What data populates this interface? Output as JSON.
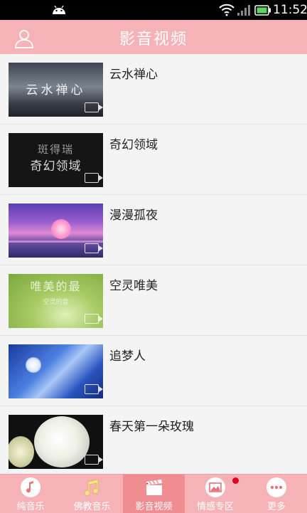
{
  "status_bar": {
    "time": "11:52"
  },
  "header": {
    "title": "影音视频"
  },
  "videos": [
    {
      "name": "云水禅心",
      "thumb_text": "云水禅心"
    },
    {
      "name": "奇幻领域",
      "thumb_text": "奇幻领域",
      "thumb_subtext": "斑得瑞"
    },
    {
      "name": "漫漫孤夜"
    },
    {
      "name": "空灵唯美",
      "thumb_text": "唯美的最",
      "thumb_subtext": "空灵的音"
    },
    {
      "name": "追梦人"
    },
    {
      "name": "春天第一朵玫瑰"
    }
  ],
  "tabs": [
    {
      "label": "纯音乐",
      "icon": "music-note-icon"
    },
    {
      "label": "佛教音乐",
      "icon": "double-note-icon"
    },
    {
      "label": "影音视频",
      "icon": "clapperboard-icon",
      "active": true
    },
    {
      "label": "情感专区",
      "icon": "image-icon",
      "badge": true
    },
    {
      "label": "更多",
      "icon": "more-dots-icon"
    }
  ]
}
